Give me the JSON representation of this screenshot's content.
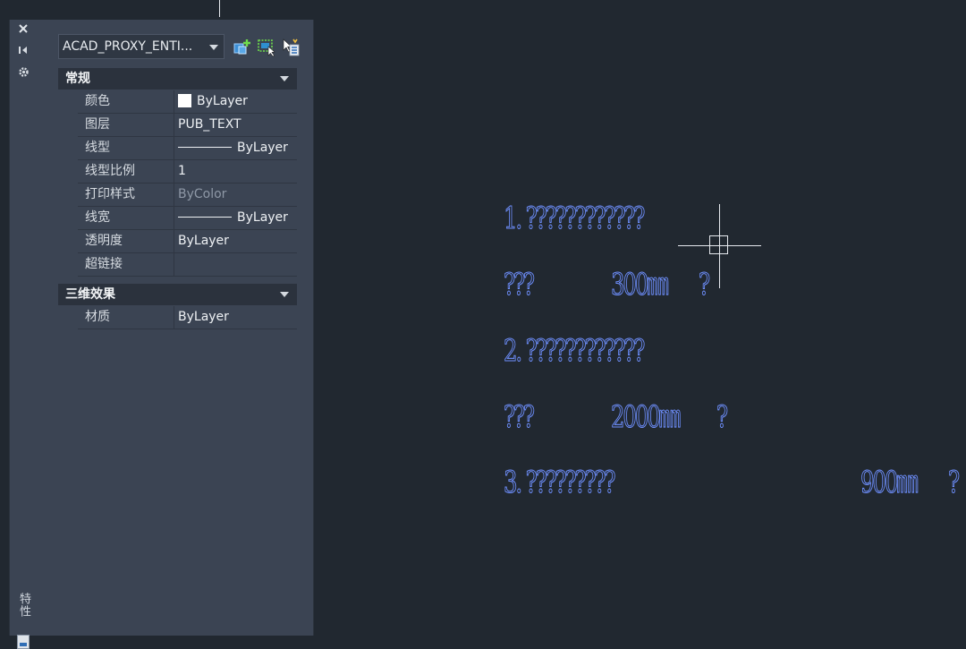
{
  "palette": {
    "title": "特性",
    "strip_icons": [
      "close-icon",
      "auto-hide-icon",
      "settings-icon"
    ],
    "object_type": "ACAD_PROXY_ENTI...",
    "toolbar_icons": [
      "toggle-pickadd-icon",
      "select-objects-icon",
      "quick-select-icon"
    ],
    "sections": [
      {
        "label": "常规",
        "rows": [
          {
            "name": "颜色",
            "value": "ByLayer",
            "swatch": "#ffffff"
          },
          {
            "name": "图层",
            "value": "PUB_TEXT"
          },
          {
            "name": "线型",
            "value": "ByLayer",
            "line": true
          },
          {
            "name": "线型比例",
            "value": "1"
          },
          {
            "name": "打印样式",
            "value": "ByColor",
            "dim": true
          },
          {
            "name": "线宽",
            "value": "ByLayer",
            "line": true
          },
          {
            "name": "透明度",
            "value": "ByLayer"
          },
          {
            "name": "超链接",
            "value": ""
          }
        ]
      },
      {
        "label": "三维效果",
        "rows": [
          {
            "name": "材质",
            "value": "ByLayer"
          }
        ]
      }
    ]
  },
  "drawing": {
    "text_color": "#6f90ff",
    "lines": [
      {
        "a": "1. ????????????"
      },
      {
        "a": "???",
        "b": "300㎜",
        "c": "?"
      },
      {
        "a": "2. ????????????"
      },
      {
        "a": "???",
        "b": "2000㎜",
        "c": "?"
      },
      {
        "a": "3. ?????????",
        "b": "900㎜",
        "c": "?"
      }
    ]
  }
}
